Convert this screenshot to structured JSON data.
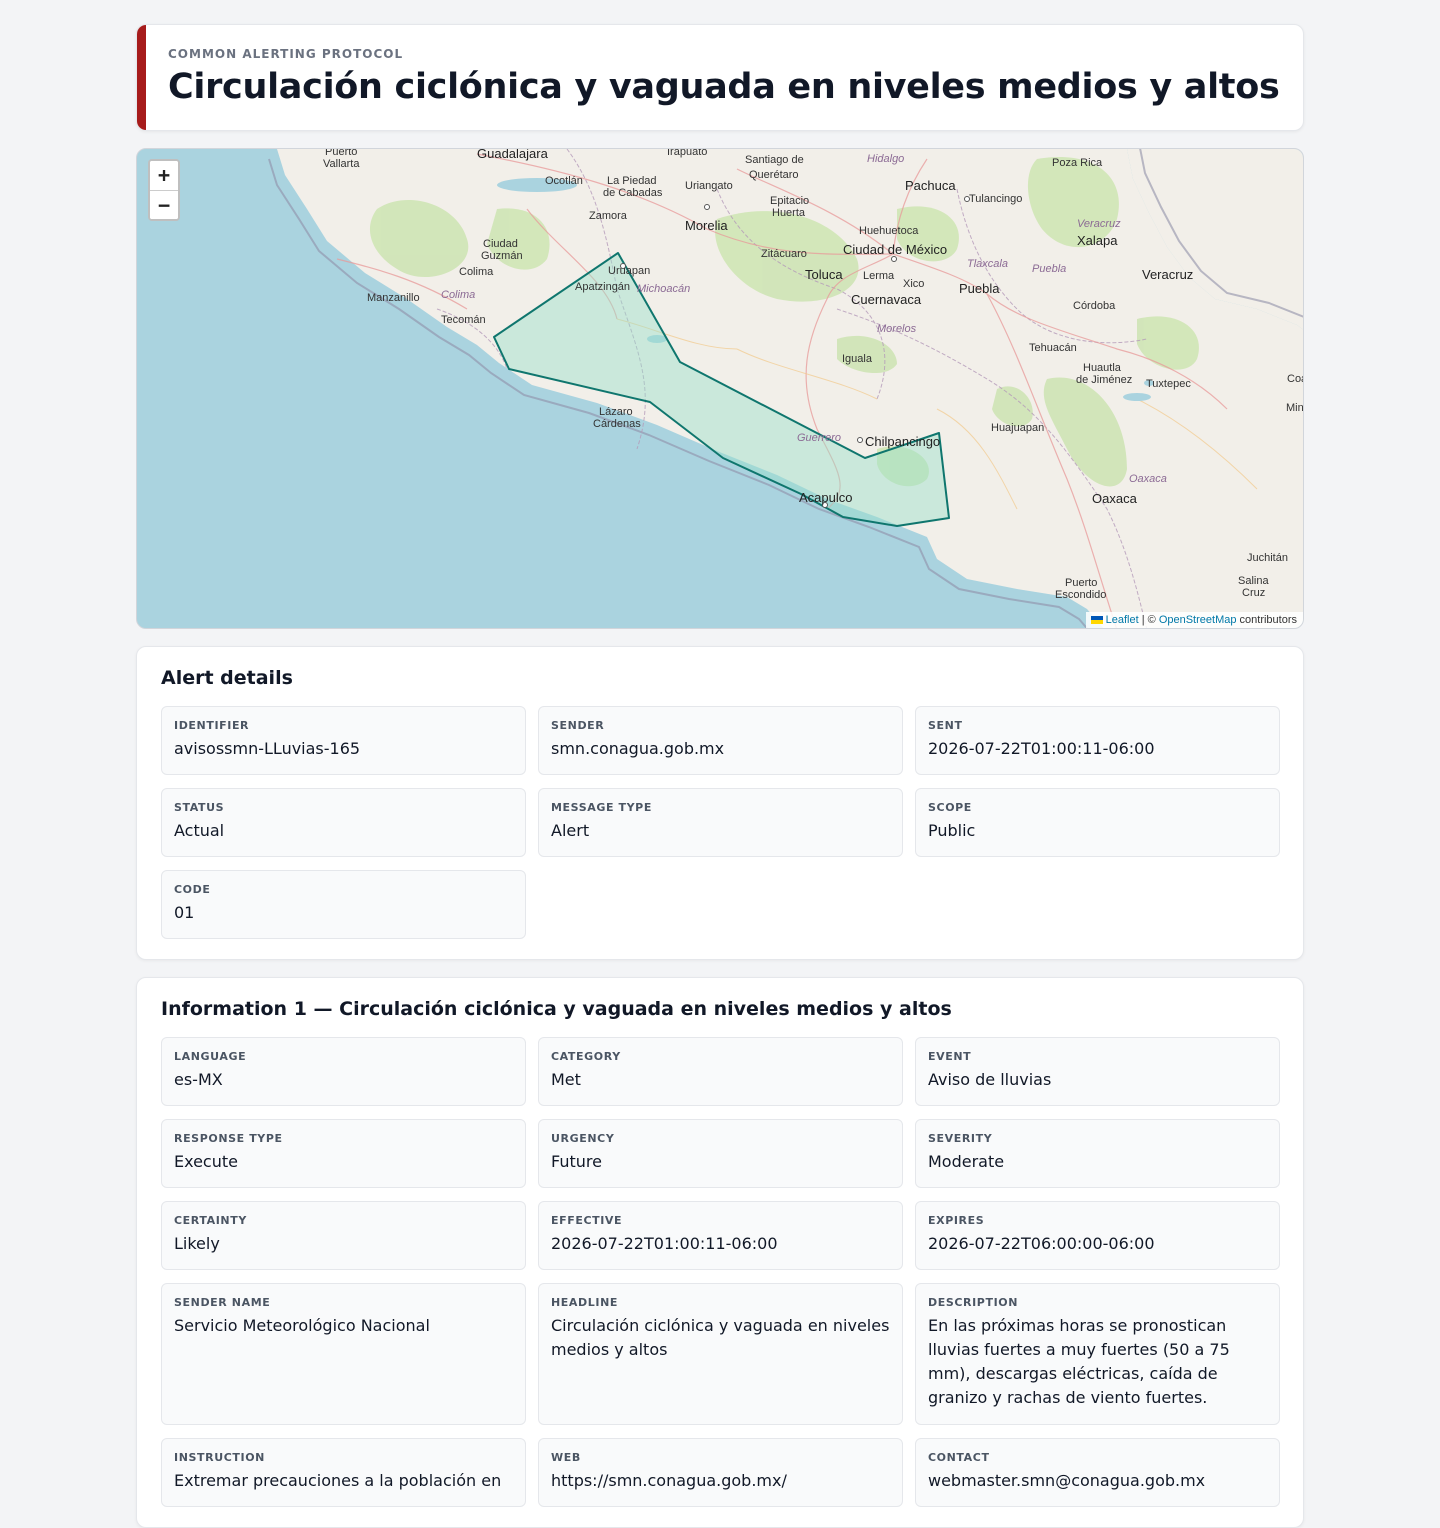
{
  "header": {
    "kicker": "Common Alerting Protocol",
    "title": "Circulación ciclónica y vaguada en niveles medios y altos"
  },
  "map": {
    "zoom_in": "+",
    "zoom_out": "−",
    "attribution": {
      "leaflet": "Leaflet",
      "separator": " | © ",
      "osm": "OpenStreetMap",
      "suffix": " contributors"
    },
    "places": {
      "puerto_vallarta_1": "Puerto",
      "puerto_vallarta_2": "Vallarta",
      "guadalajara": "Guadalajara",
      "ocotlan": "Ocotlán",
      "la_piedad_1": "La Piedad",
      "la_piedad_2": "de Cabadas",
      "irapuato": "Irapuato",
      "uriangato": "Uriangato",
      "santiago_1": "Santiago de",
      "santiago_2": "Querétaro",
      "epitacio_1": "Epitacio",
      "epitacio_2": "Huerta",
      "hidalgo": "Hidalgo",
      "pachuca": "Pachuca",
      "tulancingo": "Tulancingo",
      "poza_rica": "Poza Rica",
      "zamora": "Zamora",
      "morelia": "Morelia",
      "huehuetoca": "Huehuetoca",
      "veracruz_state": "Veracruz",
      "xalapa": "Xalapa",
      "ciudad_guzman_1": "Ciudad",
      "ciudad_guzman_2": "Guzmán",
      "colima_city": "Colima",
      "zitacuaro": "Zitácuaro",
      "ciudad_mexico": "Ciudad de México",
      "tlaxcala": "Tlaxcala",
      "puebla_state": "Puebla",
      "veracruz_city": "Veracruz",
      "uruapan": "Uruapan",
      "apatzingan": "Apatzingán",
      "michoacan": "Michoacán",
      "toluca": "Toluca",
      "lerma": "Lerma",
      "xico": "Xico",
      "puebla_city": "Puebla",
      "manzanillo": "Manzanillo",
      "colima_state": "Colima",
      "cuernavaca": "Cuernavaca",
      "cordoba": "Córdoba",
      "tecoman": "Tecomán",
      "morelos": "Morelos",
      "iguala": "Iguala",
      "tehuacan": "Tehuacán",
      "huautla_1": "Huautla",
      "huautla_2": "de Jiménez",
      "tuxtepec": "Tuxtepec",
      "coa": "Coa",
      "min": "Min",
      "lazaro_1": "Lázaro",
      "lazaro_2": "Cárdenas",
      "huajuapan": "Huajuapan",
      "guerrero": "Guerrero",
      "chilpancingo": "Chilpancingo",
      "oaxaca_state": "Oaxaca",
      "acapulco": "Acapulco",
      "oaxaca_city": "Oaxaca",
      "juchitan": "Juchitán",
      "puerto_escondido_1": "Puerto",
      "puerto_escondido_2": "Escondido",
      "salina_cruz_1": "Salina",
      "salina_cruz_2": "Cruz"
    }
  },
  "alert_details": {
    "title": "Alert details",
    "fields": [
      {
        "label": "Identifier",
        "value": "avisossmn-LLuvias-165"
      },
      {
        "label": "Sender",
        "value": "smn.conagua.gob.mx"
      },
      {
        "label": "Sent",
        "value": "2026-07-22T01:00:11-06:00"
      },
      {
        "label": "Status",
        "value": "Actual"
      },
      {
        "label": "Message type",
        "value": "Alert"
      },
      {
        "label": "Scope",
        "value": "Public"
      },
      {
        "label": "Code",
        "value": "01"
      }
    ]
  },
  "information": {
    "title": "Information 1 — Circulación ciclónica y vaguada en niveles medios y altos",
    "fields": [
      {
        "label": "Language",
        "value": "es-MX"
      },
      {
        "label": "Category",
        "value": "Met"
      },
      {
        "label": "Event",
        "value": "Aviso de lluvias"
      },
      {
        "label": "Response type",
        "value": "Execute"
      },
      {
        "label": "Urgency",
        "value": "Future"
      },
      {
        "label": "Severity",
        "value": "Moderate"
      },
      {
        "label": "Certainty",
        "value": "Likely"
      },
      {
        "label": "Effective",
        "value": "2026-07-22T01:00:11-06:00"
      },
      {
        "label": "Expires",
        "value": "2026-07-22T06:00:00-06:00"
      },
      {
        "label": "Sender name",
        "value": "Servicio Meteorológico Nacional"
      },
      {
        "label": "Headline",
        "value": "Circulación ciclónica y vaguada en niveles medios y altos"
      },
      {
        "label": "Description",
        "value": "En las próximas horas se pronostican lluvias fuertes a muy fuertes (50 a 75 mm), descargas eléctricas, caída de granizo y rachas de viento fuertes."
      },
      {
        "label": "Instruction",
        "value": "Extremar precauciones a la población en"
      },
      {
        "label": "Web",
        "value": "https://smn.conagua.gob.mx/"
      },
      {
        "label": "Contact",
        "value": "webmaster.smn@conagua.gob.mx"
      }
    ]
  },
  "colors": {
    "accent": "#a61b1b",
    "polygon_stroke": "#0f766e",
    "polygon_fill": "#99e0c9",
    "water": "#aad3df",
    "land": "#f2efe9"
  }
}
